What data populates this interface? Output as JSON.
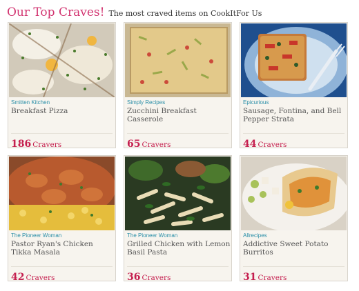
{
  "header": {
    "title": "Our Top Craves!",
    "subtitle": "The most craved items on CookItFor Us"
  },
  "cravers_label": "Cravers",
  "cards": [
    {
      "source": "Smitten Kitchen",
      "name": "Breakfast Pizza",
      "count": "186"
    },
    {
      "source": "Simply Recipes",
      "name": "Zucchini Breakfast Casserole",
      "count": "65"
    },
    {
      "source": "Epicurious",
      "name": "Sausage, Fontina, and Bell Pepper Strata",
      "count": "44"
    },
    {
      "source": "The Pioneer Woman",
      "name": "Pastor Ryan's Chicken Tikka Masala",
      "count": "42"
    },
    {
      "source": "The Pioneer Woman",
      "name": "Grilled Chicken with Lemon Basil Pasta",
      "count": "36"
    },
    {
      "source": "Allrecipes",
      "name": "Addictive Sweet Potato Burritos",
      "count": "31"
    }
  ],
  "colors": {
    "title_pink": "#d23470",
    "source_teal": "#2b8fa8",
    "count_red": "#c51f4f"
  }
}
